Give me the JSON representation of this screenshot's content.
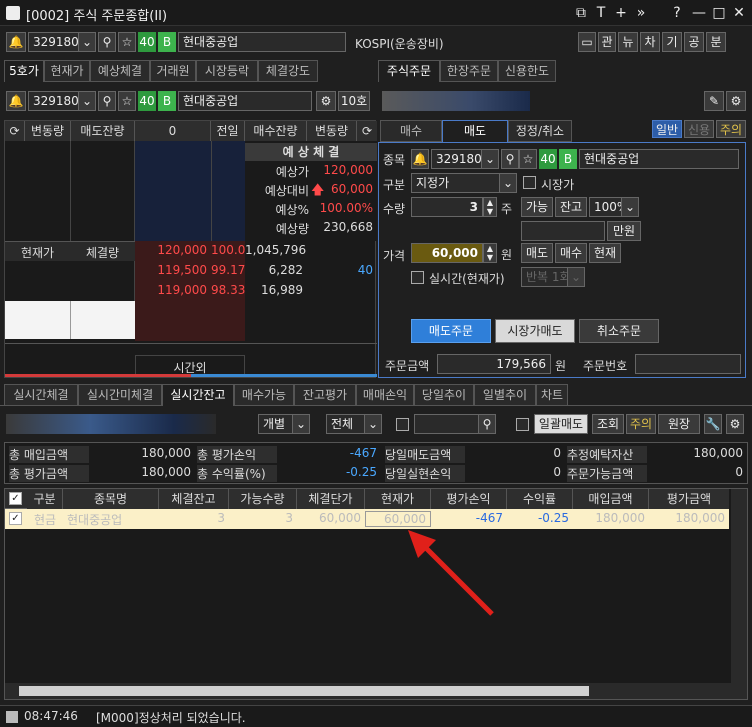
{
  "window": {
    "title": "[0002] 주식 주문종합(II)",
    "controls": [
      "⧉",
      "T",
      "+",
      "»",
      "?",
      "—",
      "□",
      "✕"
    ]
  },
  "top": {
    "code": "329180",
    "badge40": "40",
    "badgeB": "B",
    "name": "현대중공업",
    "market": "KOSPI(운송장비)",
    "tools": [
      "관",
      "뉴",
      "차",
      "기",
      "공",
      "분"
    ]
  },
  "left": {
    "tabs": [
      "5호가",
      "현재가",
      "예상체결",
      "거래원",
      "시장등락",
      "체결강도"
    ],
    "code": "329180",
    "badge40": "40",
    "badgeB": "B",
    "name": "현대중공업",
    "depth": "10호",
    "headers": {
      "c1": "변동량",
      "c2": "매도잔량",
      "c3": "0",
      "c4": "전일",
      "c5": "매수잔량",
      "c6": "변동량"
    },
    "expect": {
      "title": "예 상 체 결",
      "rows": [
        {
          "label": "예상가",
          "value": "120,000"
        },
        {
          "label": "예상대비",
          "value": "60,000"
        },
        {
          "label": "예상%",
          "value": "100.00%"
        },
        {
          "label": "예상량",
          "value": "230,668"
        }
      ]
    },
    "subhdr": {
      "price": "현재가",
      "vol": "체결량"
    },
    "bids": [
      {
        "price": "120,000",
        "pct": "100.0",
        "qty": "1,045,796",
        "chg": ""
      },
      {
        "price": "119,500",
        "pct": "99.17",
        "qty": "6,282",
        "chg": "40"
      },
      {
        "price": "119,000",
        "pct": "98.33",
        "qty": "16,989",
        "chg": ""
      }
    ],
    "afterhours": "시간외"
  },
  "right": {
    "tabs": [
      "주식주문",
      "한장주문",
      "신용한도"
    ],
    "modes": [
      "일반",
      "신용",
      "주의"
    ],
    "subtabs": [
      "매수",
      "매도",
      "정정/취소"
    ],
    "labels": {
      "code": "종목",
      "type": "구분",
      "qty": "수량",
      "price": "가격",
      "realtime": "실시간(현재가)",
      "market": "시장가"
    },
    "code": "329180",
    "badge40": "40",
    "badgeB": "B",
    "name": "현대중공업",
    "type": "지정가",
    "qty": "3",
    "qty_unit": "주",
    "avail": "가능",
    "balance": "잔고",
    "pct": "100%",
    "manwon": "만원",
    "price": "60,000",
    "price_unit": "원",
    "p_sell": "매도",
    "p_buy": "매수",
    "p_cur": "현재",
    "repeat": "반복 1회",
    "btn_sell": "매도주문",
    "btn_market": "시장가매도",
    "btn_cancel": "취소주문",
    "amount_label": "주문금액",
    "amount": "179,566",
    "amount_unit": "원",
    "orderno_label": "주문번호"
  },
  "bottom": {
    "tabs": [
      "실시간체결",
      "실시간미체결",
      "실시간잔고",
      "매수가능",
      "잔고평가",
      "매매손익",
      "당일추이",
      "일별추이",
      "차트"
    ],
    "filter1": "개별",
    "filter2": "전체",
    "b_bulk": "일괄매도",
    "b_query": "조회",
    "b_note": "주의",
    "b_ledger": "원장",
    "summary": [
      {
        "l": "총 매입금액",
        "v": "180,000",
        "l2": "총 평가손익",
        "v2": "-467",
        "l3": "당일매도금액",
        "v3": "0",
        "l4": "추정예탁자산",
        "v4": "180,000"
      },
      {
        "l": "총 평가금액",
        "v": "180,000",
        "l2": "총 수익률(%)",
        "v2": "-0.25",
        "l3": "당일실현손익",
        "v3": "0",
        "l4": "주문가능금액",
        "v4": "0"
      }
    ],
    "cols": [
      "구분",
      "종목명",
      "체결잔고",
      "가능수량",
      "체결단가",
      "현재가",
      "평가손익",
      "수익률",
      "매입금액",
      "평가금액"
    ],
    "rows": [
      [
        "현금",
        "현대중공업",
        "3",
        "3",
        "60,000",
        "60,000",
        "-467",
        "-0.25",
        "180,000",
        "180,000"
      ]
    ]
  },
  "status": {
    "time": "08:47:46",
    "msg": "[M000]정상처리 되었습니다."
  }
}
